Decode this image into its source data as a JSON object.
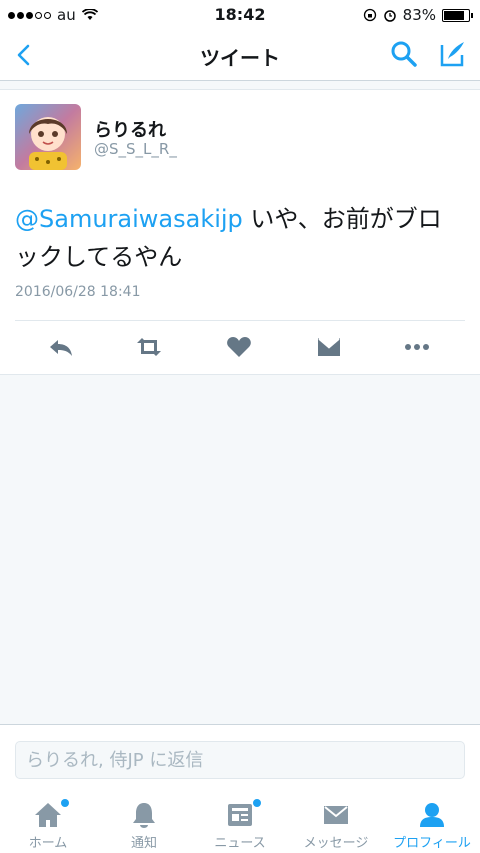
{
  "status_bar": {
    "carrier": "au",
    "time": "18:42",
    "battery": "83%",
    "battery_level": 0.83
  },
  "nav": {
    "title": "ツイート"
  },
  "tweet": {
    "display_name": "らりるれ",
    "handle": "@S_S_L_R_",
    "mention": "@Samuraiwasakijp",
    "text": " いや、お前がブロックしてるやん",
    "timestamp": "2016/06/28 18:41"
  },
  "reply": {
    "placeholder": "らりるれ, 侍JP に返信"
  },
  "tabs": [
    {
      "label": "ホーム",
      "icon": "home-icon",
      "badge": true
    },
    {
      "label": "通知",
      "icon": "bell-icon",
      "badge": false
    },
    {
      "label": "ニュース",
      "icon": "news-icon",
      "badge": true
    },
    {
      "label": "メッセージ",
      "icon": "mail-icon",
      "badge": false
    },
    {
      "label": "プロフィール",
      "icon": "person-icon",
      "badge": false,
      "active": true
    }
  ],
  "colors": {
    "accent": "#1da1f2",
    "muted": "#8899a6",
    "icon": "#657786"
  }
}
